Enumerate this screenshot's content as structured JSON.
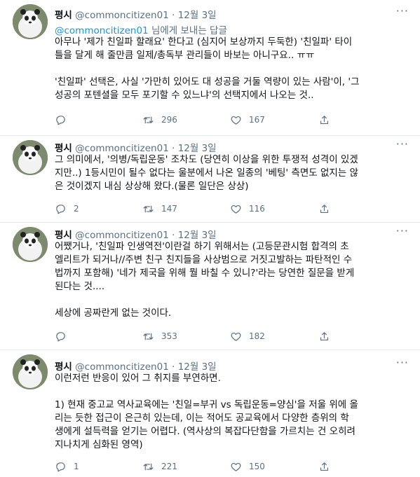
{
  "tweets": [
    {
      "name": "평시",
      "handle": "@commoncitizen01",
      "dot": "·",
      "date": "12월 3일",
      "reply_mention": "@commoncitizen01",
      "reply_suffix": " 님에게 보내는 답글",
      "lines": [
        "아무나 '제가 친일파 할래요' 한다고 (심지어 보상까지 두둑한) '친일파' 타이",
        "틀을 달게 해 줄만큼 일제/총독부 관리들이 바보는 아니구요.. ㅠㅠ",
        "",
        "'친일파' 선택은, 사실 '가만히 있어도 대 성공을 거둘 역량이 있는 사람'이, '그",
        "성공의 포텐셜을 모두 포기할 수 있느냐'의 선택지에서 나오는 것.."
      ],
      "replies": "",
      "retweets": "296",
      "likes": "167"
    },
    {
      "name": "평시",
      "handle": "@commoncitizen01",
      "dot": "·",
      "date": "12월 3일",
      "lines": [
        "그 의미에서, '의병/독립운동' 조차도 (당연히 이상을 위한 투쟁적 성격이 있겠",
        "지만..) 1등시민이 될수 없다는 울분에서 나온 일종의 '베팅' 측면도 없지는 않",
        "은 것이겠지 내심 상상해 왔다.(물론 일단은 상상)"
      ],
      "replies": "2",
      "retweets": "147",
      "likes": "116"
    },
    {
      "name": "평시",
      "handle": "@commoncitizen01",
      "dot": "·",
      "date": "12월 3일",
      "lines": [
        "어쨌거나, '친일파 인생역전'이란걸 하기 위해서는 (고등문관시험 합격의 초",
        "엘리트가 되거나//주변 친구 친지들을 사상범으로 거짓고발하는 파탄적인 수",
        "법까지 포함해) '네가 제국을 위해 뭘 바칠 수 있니?'라는 당연한 질문을 받게",
        "된다는 것....",
        "",
        "세상에 공짜란게 없는 것이다."
      ],
      "replies": "",
      "retweets": "353",
      "likes": "182"
    },
    {
      "name": "평시",
      "handle": "@commoncitizen01",
      "dot": "·",
      "date": "12월 3일",
      "lines": [
        "이런저런 반응이 있어 그 취지를 부연하면.",
        "",
        "1) 현재 중고교 역사교육에는 '친일=부귀 vs 독립운동=양심'을 저울 위에 올",
        "리는 듯한 접근이 은근히 있는데, 이는 적어도 공교육에서 다양한 층위의 학",
        "생에게 설득력을 얻기는 어렵다. (역사상의 복잡다단함을 가르치는 건 오히려",
        "지나치게 심화된 영역)"
      ],
      "replies": "1",
      "retweets": "221",
      "likes": "150"
    }
  ],
  "icons": {
    "reply": "reply-icon",
    "retweet": "retweet-icon",
    "like": "like-icon",
    "share": "share-icon",
    "more": "more-icon"
  },
  "colors": {
    "text": "#0f1419",
    "muted": "#5b7083",
    "link": "#1b95e0",
    "divider": "#e6ecf0"
  }
}
